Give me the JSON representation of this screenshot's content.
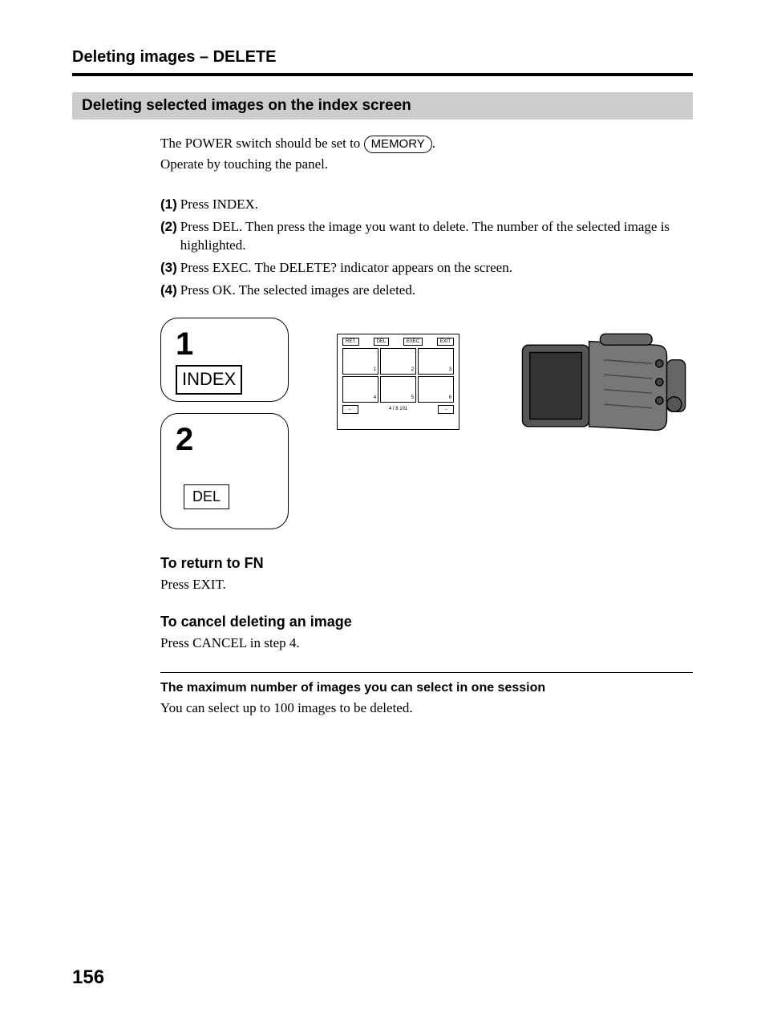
{
  "header": "Deleting images – DELETE",
  "section_heading": "Deleting selected images on the index screen",
  "intro": {
    "line1_pre": "The POWER switch should be set to ",
    "memory_label": "MEMORY",
    "line1_post": ".",
    "line2": "Operate by touching the panel."
  },
  "steps": [
    {
      "num": "(1)",
      "text": "Press INDEX."
    },
    {
      "num": "(2)",
      "text": "Press DEL. Then press the image you want to delete. The number of the selected image is highlighted."
    },
    {
      "num": "(3)",
      "text": "Press EXEC. The DELETE? indicator appears on the screen."
    },
    {
      "num": "(4)",
      "text": "Press OK. The selected images are deleted."
    }
  ],
  "figure": {
    "panel1": {
      "num": "1",
      "label": "INDEX"
    },
    "panel2": {
      "num": "2",
      "label": "DEL"
    },
    "screen": {
      "buttons": {
        "ret": "RET.",
        "del": "DEL",
        "exec": "EXEC",
        "exit": "EXIT"
      },
      "cells": [
        "1",
        "2",
        "3",
        "4",
        "5",
        "6"
      ],
      "counter": "4 / 8",
      "folder": "101"
    }
  },
  "return_fn": {
    "heading": "To return to FN",
    "text": "Press EXIT."
  },
  "cancel": {
    "heading": "To cancel deleting an image",
    "text": "Press CANCEL in step 4."
  },
  "note": {
    "heading": "The maximum number of images you can select in one session",
    "text": "You can select up to 100 images to be deleted."
  },
  "page_number": "156"
}
